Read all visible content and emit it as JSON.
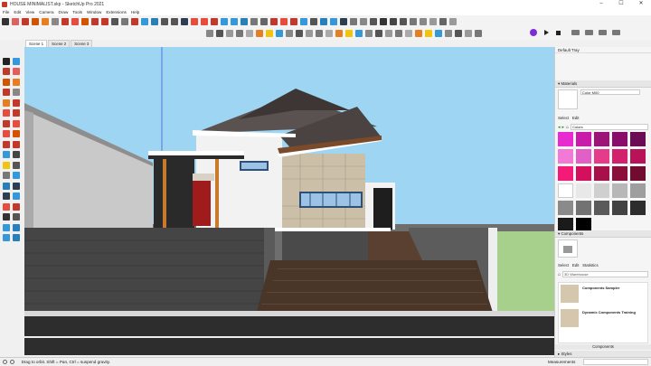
{
  "window": {
    "title": "HOUSE MINIMALIST.skp - SketchUp Pro 2021"
  },
  "menu": [
    "File",
    "Edit",
    "View",
    "Camera",
    "Draw",
    "Tools",
    "Window",
    "Extensions",
    "Help"
  ],
  "scenes": [
    "Scene 1",
    "Scene 2",
    "Scene 3"
  ],
  "tray": {
    "title": "Default Tray",
    "materials": {
      "header": "Materials",
      "current_material": "Color M00",
      "tabs": [
        "Select",
        "Edit"
      ],
      "library": "Colors",
      "swatches": [
        "#e82bd0",
        "#c91ba9",
        "#9c1478",
        "#8a0c6a",
        "#6b0a55",
        "#f27ad6",
        "#e060c8",
        "#e63b8a",
        "#d3206c",
        "#b81358",
        "#f31b77",
        "#d3105e",
        "#a8104a",
        "#8a0d3a",
        "#720b30",
        "#ffffff",
        "#e8e8e8",
        "#cfcfcf",
        "#b7b7b7",
        "#9e9e9e",
        "#8a8a8a",
        "#727272",
        "#5a5a5a",
        "#434343",
        "#2d2d2d",
        "#1a1a1a",
        "#000000"
      ]
    },
    "components": {
      "header": "Components",
      "tabs": [
        "Select",
        "Edit",
        "Statistics"
      ],
      "search_placeholder": "3D Warehouse",
      "items": [
        {
          "name": "Components Sampler"
        },
        {
          "name": "Dynamic Components Training"
        }
      ],
      "footer": "Components"
    },
    "styles": {
      "header": "Styles"
    }
  },
  "status": {
    "hint": "Drag to orbit. Shift = Pan, Ctrl = suspend gravity.",
    "measurements_label": "Measurements"
  },
  "icons": {
    "toolbar1": [
      "select-icon",
      "eraser-icon",
      "paint-icon",
      "line-icon",
      "arc-icon",
      "rectangle-icon",
      "pushpull-icon",
      "move-icon",
      "rotate-icon",
      "scale-icon",
      "offset-icon",
      "tape-icon",
      "text-icon",
      "axes-icon",
      "orbit-icon",
      "pan-icon",
      "zoom-icon",
      "zoom-extents-icon"
    ],
    "right_toolbar": [
      "extension-icon",
      "play-icon",
      "stop-icon"
    ]
  }
}
